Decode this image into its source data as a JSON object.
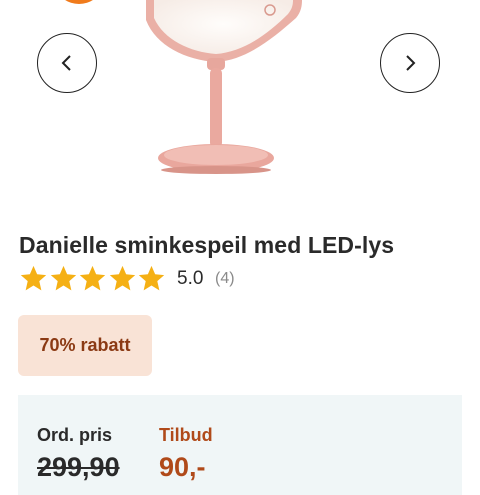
{
  "product": {
    "title": "Danielle sminkespeil med LED-lys",
    "rating": {
      "value": "5.0",
      "count": "(4)",
      "stars": 5
    },
    "discount_label": "70% rabatt"
  },
  "carousel": {
    "prev_icon": "chevron-left-icon",
    "next_icon": "chevron-right-icon"
  },
  "prices": {
    "ordinary_label": "Ord. pris",
    "ordinary_value": "299,90",
    "offer_label": "Tilbud",
    "offer_value": "90,-"
  },
  "colors": {
    "accent": "#f07b1c",
    "star": "#f5b014",
    "offer": "#b04a1a",
    "discount_bg": "#f9e3d6",
    "mirror": "#e9aaa2"
  }
}
